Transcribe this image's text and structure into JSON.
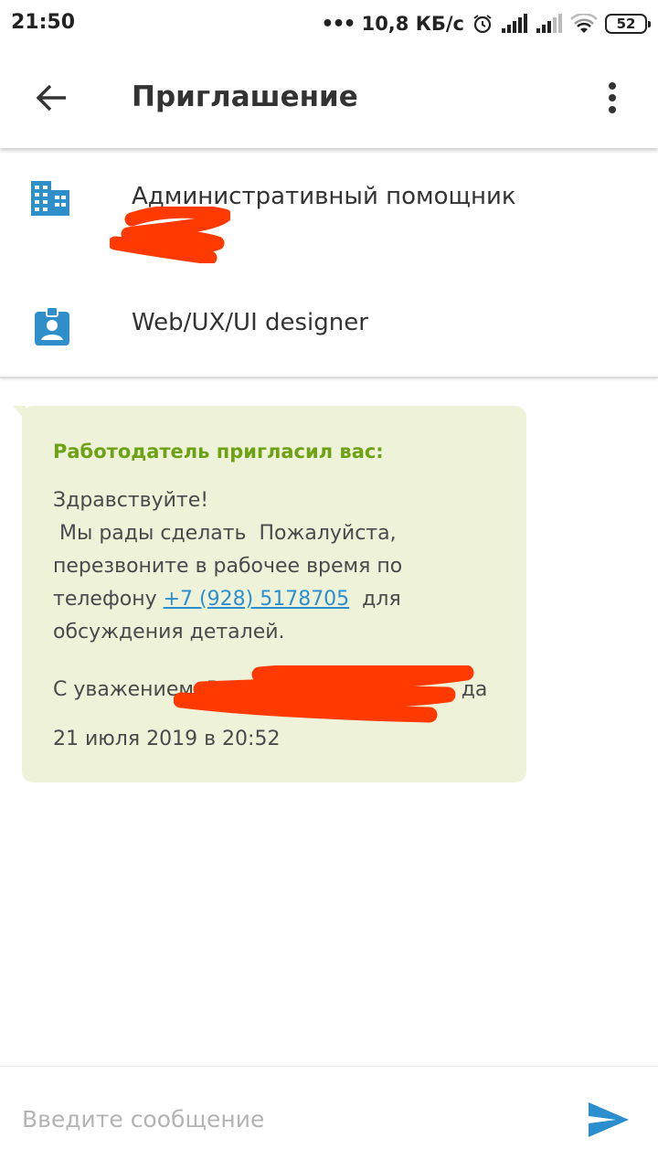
{
  "status_bar": {
    "time": "21:50",
    "dots": "•••",
    "speed": "10,8 КБ/с",
    "battery": "52",
    "icons": [
      "alarm-icon",
      "signal-icon",
      "signal-icon",
      "wifi-icon",
      "battery-icon"
    ]
  },
  "app_bar": {
    "title": "Приглашение",
    "back_icon": "arrow-back-icon",
    "menu_icon": "more-vert-icon"
  },
  "vacancy": {
    "position": "Административный помощник",
    "position_icon": "building-icon",
    "resume": "Web/UX/UI designer",
    "resume_icon": "badge-icon"
  },
  "message": {
    "heading": "Работодатель пригласил вас:",
    "lines": {
      "l1": "Здравствуйте!",
      "l2": " Мы рады сделать  Пожалуйста,",
      "l3": "перезвоните в рабочее время по",
      "l4_prefix": "телефону ",
      "l4_phone": "+7 (928) 5178705",
      "l4_suffix": "  для",
      "l5": "обсуждения деталей."
    },
    "signature": "С уважением, Викто                              да",
    "date": "21 июля 2019 в 20:52"
  },
  "input": {
    "placeholder": "Введите сообщение",
    "send_icon": "send-icon"
  },
  "colors": {
    "accent": "#2b8fcf",
    "heading_green": "#6ea215",
    "bubble_bg": "#eef2d9",
    "redaction": "#ff3a00"
  }
}
